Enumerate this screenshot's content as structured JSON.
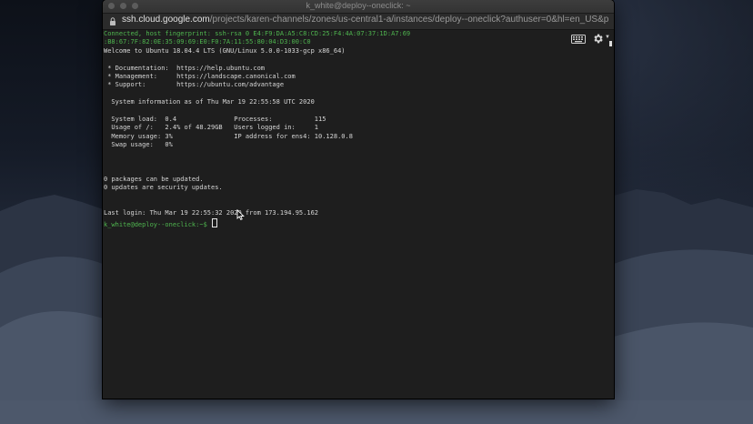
{
  "window": {
    "title": "k_white@deploy--oneclick: ~"
  },
  "browser": {
    "url_host": "ssh.cloud.google.com",
    "url_path": "/projects/karen-channels/zones/us-central1-a/instances/deploy--oneclick?authuser=0&hl=en_US&proje..."
  },
  "terminal": {
    "connect_line1": "Connected, host fingerprint: ssh-rsa 0 E4:F9:DA:A5:C8:CD:25:F4:4A:07:37:1D:A7:69",
    "connect_line2": ":B8:67:7F:82:0E:35:09:69:E0:F0:7A:11:55:80:04:D3:00:C0",
    "welcome": "Welcome to Ubuntu 18.04.4 LTS (GNU/Linux 5.0.0-1033-gcp x86_64)",
    "doc_line": " * Documentation:  https://help.ubuntu.com",
    "mgmt_line": " * Management:     https://landscape.canonical.com",
    "support_line": " * Support:        https://ubuntu.com/advantage",
    "sysinfo_line": "  System information as of Thu Mar 19 22:55:58 UTC 2020",
    "stats1": "  System load:  0.4               Processes:           115",
    "stats2": "  Usage of /:   2.4% of 48.29GB   Users logged in:     1",
    "stats3": "  Memory usage: 3%                IP address for ens4: 10.128.0.8",
    "stats4": "  Swap usage:   0%",
    "packages_line": "0 packages can be updated.",
    "security_line": "0 updates are security updates.",
    "last_login": "Last login: Thu Mar 19 22:55:32 2020 from 173.194.95.162",
    "prompt": "k_white@deploy--oneclick:~$"
  },
  "icons": {
    "lock": "lock-icon",
    "keyboard": "keyboard-icon",
    "settings": "gear-icon",
    "pointer": "mouse-pointer-icon"
  },
  "colors": {
    "prompt_green": "#4fb54f",
    "terminal_bg": "#1e1e1e"
  }
}
